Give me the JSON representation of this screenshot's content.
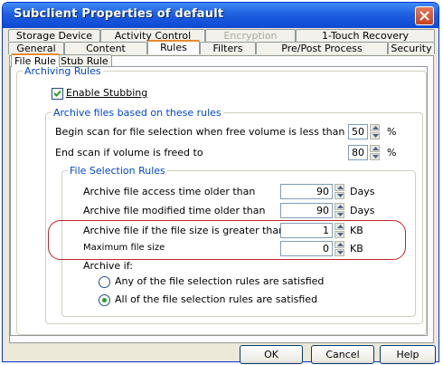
{
  "window": {
    "title": "Subclient Properties of default",
    "close_icon": "close-icon"
  },
  "tabs_row1": [
    {
      "label": "Storage Device",
      "disabled": false
    },
    {
      "label": "Activity Control",
      "disabled": false
    },
    {
      "label": "Encryption",
      "disabled": true
    },
    {
      "label": "1-Touch Recovery",
      "disabled": false
    }
  ],
  "tabs_row2": [
    {
      "label": "General"
    },
    {
      "label": "Content"
    },
    {
      "label": "Rules",
      "active": true
    },
    {
      "label": "Filters"
    },
    {
      "label": "Pre/Post Process"
    },
    {
      "label": "Security"
    }
  ],
  "subtabs": [
    {
      "label": "File Rule",
      "active": true
    },
    {
      "label": "Stub Rule"
    }
  ],
  "archiving_rules": {
    "legend": "Archiving Rules",
    "enable_stubbing": {
      "label": "Enable Stubbing",
      "checked": true
    }
  },
  "archive_files": {
    "legend": "Archive files based on these rules",
    "begin_scan": {
      "label": "Begin scan for file selection when free volume is less than",
      "value": "50",
      "unit": "%"
    },
    "end_scan": {
      "label": "End scan if volume is freed to",
      "value": "80",
      "unit": "%"
    }
  },
  "file_selection": {
    "legend": "File Selection Rules",
    "access_time": {
      "label": "Archive file access time older than",
      "value": "90",
      "unit": "Days"
    },
    "modified_time": {
      "label": "Archive file modified time older than",
      "value": "90",
      "unit": "Days"
    },
    "size_greater": {
      "label": "Archive file if the file size is greater than",
      "value": "1",
      "unit": "KB"
    },
    "max_size": {
      "label": "Maximum file size",
      "value": "0",
      "unit": "KB"
    },
    "archive_if": {
      "label": "Archive if:",
      "options": [
        {
          "label": "Any of the file selection rules are satisfied",
          "selected": false
        },
        {
          "label": "All of the file selection rules are satisfied",
          "selected": true
        }
      ]
    }
  },
  "buttons": {
    "ok": "OK",
    "cancel": "Cancel",
    "help": "Help"
  },
  "colors": {
    "title_bar": "#0B49D3",
    "legend_text": "#0046D5",
    "highlight": "#C0262C",
    "radio_selected": "#21A121"
  }
}
